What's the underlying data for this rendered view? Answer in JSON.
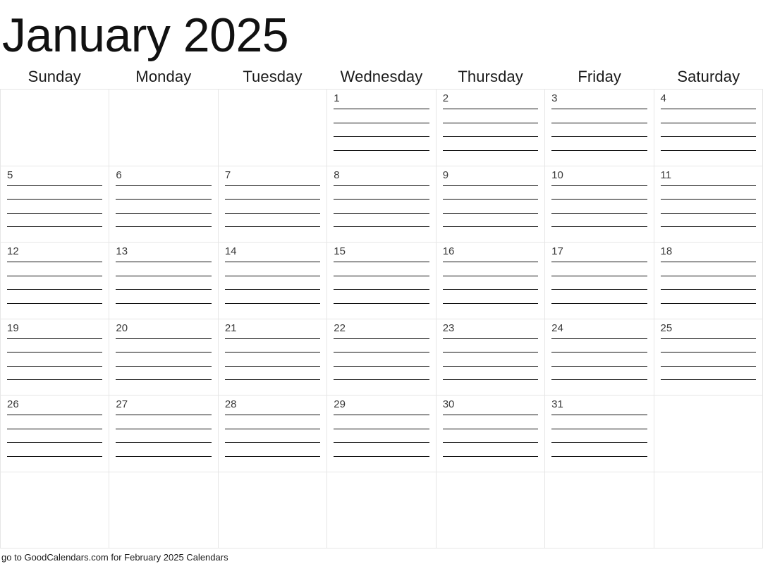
{
  "title": "January 2025",
  "month": "January",
  "year": "2025",
  "weekdays": [
    "Sunday",
    "Monday",
    "Tuesday",
    "Wednesday",
    "Thursday",
    "Friday",
    "Saturday"
  ],
  "lines_per_day": 4,
  "colors": {
    "grid_border": "#e6e6e6",
    "rule_line": "#111111",
    "day_number": "#3a3a3a",
    "title": "#111111",
    "background": "#ffffff"
  },
  "weeks": [
    [
      {
        "date": "",
        "lines": 0
      },
      {
        "date": "",
        "lines": 0
      },
      {
        "date": "",
        "lines": 0
      },
      {
        "date": "1",
        "lines": 4
      },
      {
        "date": "2",
        "lines": 4
      },
      {
        "date": "3",
        "lines": 4
      },
      {
        "date": "4",
        "lines": 4
      }
    ],
    [
      {
        "date": "5",
        "lines": 4
      },
      {
        "date": "6",
        "lines": 4
      },
      {
        "date": "7",
        "lines": 4
      },
      {
        "date": "8",
        "lines": 4
      },
      {
        "date": "9",
        "lines": 4
      },
      {
        "date": "10",
        "lines": 4
      },
      {
        "date": "11",
        "lines": 4
      }
    ],
    [
      {
        "date": "12",
        "lines": 4
      },
      {
        "date": "13",
        "lines": 4
      },
      {
        "date": "14",
        "lines": 4
      },
      {
        "date": "15",
        "lines": 4
      },
      {
        "date": "16",
        "lines": 4
      },
      {
        "date": "17",
        "lines": 4
      },
      {
        "date": "18",
        "lines": 4
      }
    ],
    [
      {
        "date": "19",
        "lines": 4
      },
      {
        "date": "20",
        "lines": 4
      },
      {
        "date": "21",
        "lines": 4
      },
      {
        "date": "22",
        "lines": 4
      },
      {
        "date": "23",
        "lines": 4
      },
      {
        "date": "24",
        "lines": 4
      },
      {
        "date": "25",
        "lines": 4
      }
    ],
    [
      {
        "date": "26",
        "lines": 4
      },
      {
        "date": "27",
        "lines": 4
      },
      {
        "date": "28",
        "lines": 4
      },
      {
        "date": "29",
        "lines": 4
      },
      {
        "date": "30",
        "lines": 4
      },
      {
        "date": "31",
        "lines": 4
      },
      {
        "date": "",
        "lines": 0
      }
    ],
    [
      {
        "date": "",
        "lines": 0
      },
      {
        "date": "",
        "lines": 0
      },
      {
        "date": "",
        "lines": 0
      },
      {
        "date": "",
        "lines": 0
      },
      {
        "date": "",
        "lines": 0
      },
      {
        "date": "",
        "lines": 0
      },
      {
        "date": "",
        "lines": 0
      }
    ]
  ],
  "footer": {
    "note": "go to GoodCalendars.com for February 2025 Calendars"
  }
}
